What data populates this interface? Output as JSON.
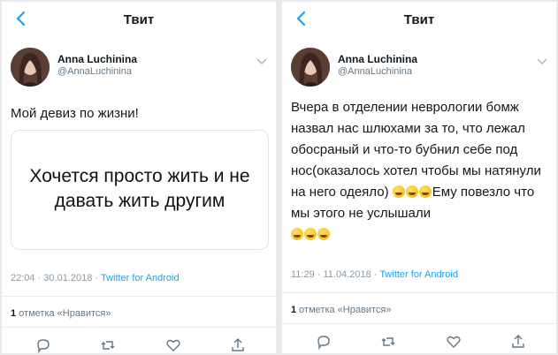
{
  "colors": {
    "accent": "#1da1f2",
    "text": "#14171a",
    "muted": "#657786",
    "meta": "#8899a6"
  },
  "icons": [
    "back-arrow-icon",
    "chevron-down-icon",
    "reply-icon",
    "retweet-icon",
    "like-icon",
    "share-icon",
    "laughing-emoji-icon"
  ],
  "left": {
    "title": "Твит",
    "author": {
      "name": "Anna Luchinina",
      "handle": "@AnnaLuchinina"
    },
    "text": "Мой девиз по жизни!",
    "quote_card": {
      "text": "Хочется просто жить и не давать жить другим"
    },
    "time": "22:04 · 30.01.2018 · ",
    "source": "Twitter for Android",
    "likes_count": "1",
    "likes_label": " отметка «Нравится»"
  },
  "right": {
    "title": "Твит",
    "author": {
      "name": "Anna Luchinina",
      "handle": "@AnnaLuchinina"
    },
    "text_part1": "Вчера в отделении неврологии бомж назвал нас шлюхами за то, что лежал обосраный и что-то бубнил себе под нос(оказалось хотел чтобы мы натянули на него одеяло) ",
    "text_part2": "Ему повезло что мы этого не услышали",
    "emoji_group1_count": 3,
    "emoji_group2_count": 3,
    "time": "11:29 · 11.04.2018 · ",
    "source": "Twitter for Android",
    "likes_count": "1",
    "likes_label": " отметка «Нравится»"
  }
}
